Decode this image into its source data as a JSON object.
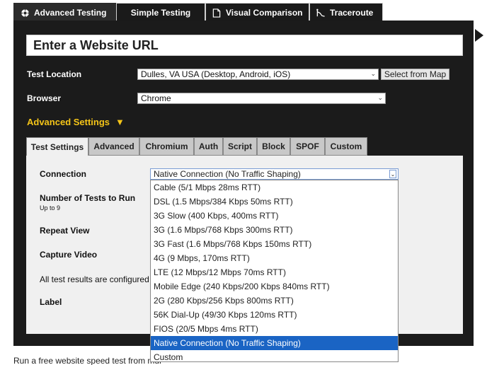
{
  "top_tabs": [
    {
      "label": "Advanced Testing",
      "icon": "gear-icon"
    },
    {
      "label": "Simple Testing"
    },
    {
      "label": "Visual Comparison",
      "icon": "document-icon"
    },
    {
      "label": "Traceroute",
      "icon": "route-icon"
    }
  ],
  "url_input": {
    "placeholder": "Enter a Website URL"
  },
  "test_location": {
    "label": "Test Location",
    "value": "Dulles, VA USA (Desktop, Android, iOS)",
    "map_button": "Select from Map"
  },
  "browser": {
    "label": "Browser",
    "value": "Chrome"
  },
  "advanced_settings": {
    "label": "Advanced Settings",
    "arrow": "▼"
  },
  "inner_tabs": [
    "Test Settings",
    "Advanced",
    "Chromium",
    "Auth",
    "Script",
    "Block",
    "SPOF",
    "Custom"
  ],
  "settings": {
    "connection_label": "Connection",
    "connection_value": "Native Connection (No Traffic Shaping)",
    "tests_label": "Number of Tests to Run",
    "tests_sub": "Up to 9",
    "repeat_label": "Repeat View",
    "capture_label": "Capture Video",
    "results_text": "All test results are configured to",
    "label_label": "Label"
  },
  "connection_options": [
    "Cable (5/1 Mbps 28ms RTT)",
    "DSL (1.5 Mbps/384 Kbps 50ms RTT)",
    "3G Slow (400 Kbps, 400ms RTT)",
    "3G (1.6 Mbps/768 Kbps 300ms RTT)",
    "3G Fast (1.6 Mbps/768 Kbps 150ms RTT)",
    "4G (9 Mbps, 170ms RTT)",
    "LTE (12 Mbps/12 Mbps 70ms RTT)",
    "Mobile Edge (240 Kbps/200 Kbps 840ms RTT)",
    "2G (280 Kbps/256 Kbps 800ms RTT)",
    "56K Dial-Up (49/30 Kbps 120ms RTT)",
    "FIOS (20/5 Mbps 4ms RTT)",
    "Native Connection (No Traffic Shaping)",
    "Custom"
  ],
  "footer": {
    "text": "Run a free website speed test from mul"
  },
  "colors": {
    "panel": "#1b1b1b",
    "accent": "#f5c518",
    "selected": "#1a64c4"
  }
}
